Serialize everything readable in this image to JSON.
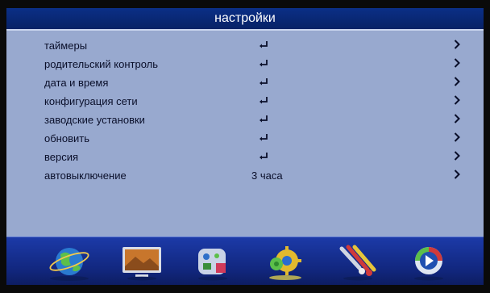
{
  "header": {
    "title": "настройки"
  },
  "menu": {
    "items": [
      {
        "label": "таймеры",
        "value": ""
      },
      {
        "label": "родительский контроль",
        "value": ""
      },
      {
        "label": "дата и время",
        "value": ""
      },
      {
        "label": "конфигурация сети",
        "value": ""
      },
      {
        "label": "заводские установки",
        "value": ""
      },
      {
        "label": "обновить",
        "value": ""
      },
      {
        "label": "версия",
        "value": ""
      },
      {
        "label": "автовыключение",
        "value": "3 часа"
      }
    ]
  },
  "dock": {
    "icons": [
      "globe-icon",
      "tv-monitor-icon",
      "media-apps-icon",
      "settings-gear-icon",
      "av-cables-icon",
      "play-icon"
    ],
    "selected_index": 3
  },
  "colors": {
    "title_bar": "#0b2f86",
    "content_bg": "#98a9cf",
    "dock_bg": "#1c3aa8",
    "text": "#0a0f2a"
  }
}
